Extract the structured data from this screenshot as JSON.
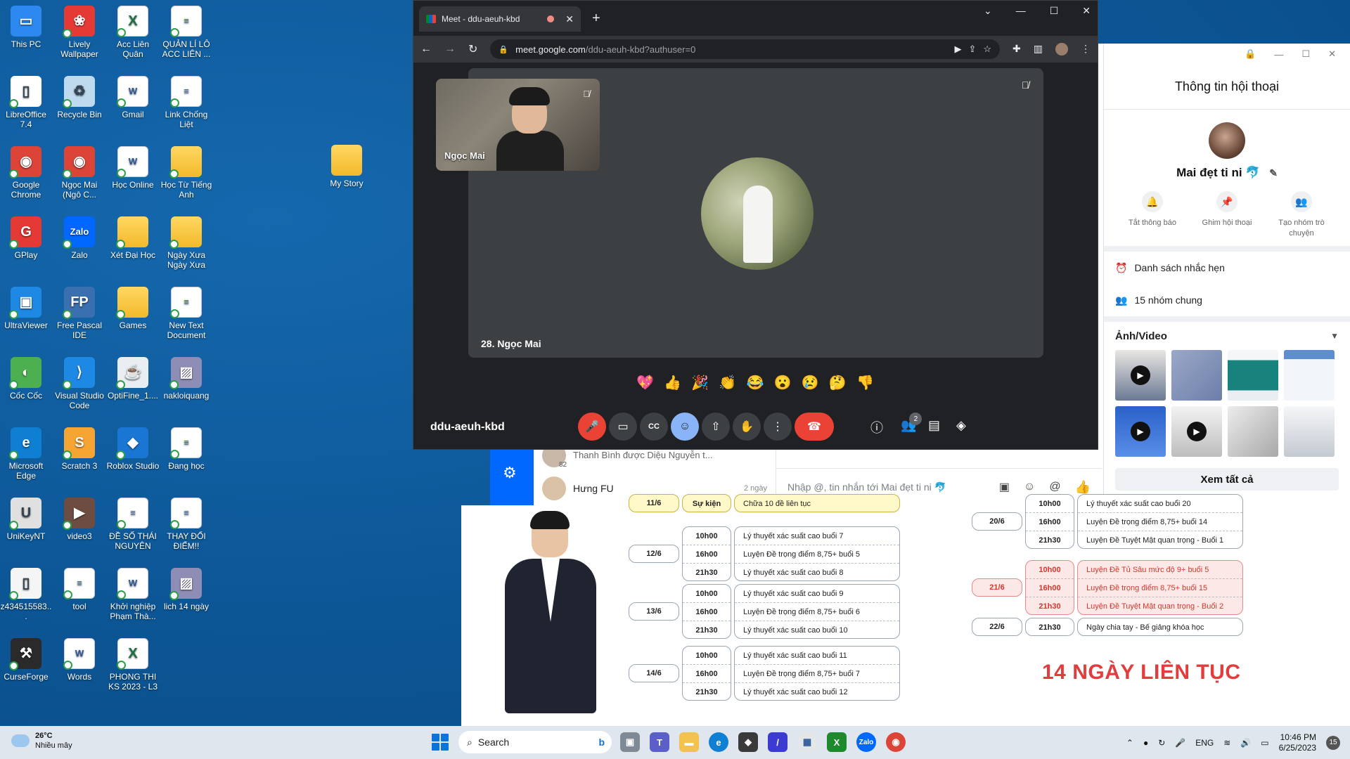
{
  "desktop": {
    "icons": [
      {
        "label": "This PC",
        "icon": "monitor-icon"
      },
      {
        "label": "LibreOffice 7.4",
        "icon": "libreoffice-icon"
      },
      {
        "label": "Google Chrome",
        "icon": "chrome-icon"
      },
      {
        "label": "GPlay",
        "icon": "gplay-icon"
      },
      {
        "label": "UltraViewer",
        "icon": "ultraviewer-icon"
      },
      {
        "label": "Cốc Cốc",
        "icon": "coccoc-icon"
      },
      {
        "label": "Microsoft Edge",
        "icon": "edge-icon"
      },
      {
        "label": "UniKeyNT",
        "icon": "unikey-icon"
      },
      {
        "label": "z434515583...",
        "icon": "file-icon"
      },
      {
        "label": "CurseForge",
        "icon": "curseforge-icon"
      },
      {
        "label": "Lively Wallpaper",
        "icon": "lively-icon"
      },
      {
        "label": "Recycle Bin",
        "icon": "recycle-bin-icon"
      },
      {
        "label": "Ngọc Mai (Ngô C...",
        "icon": "chrome-profile-icon"
      },
      {
        "label": "Zalo",
        "icon": "zalo-icon"
      },
      {
        "label": "Free Pascal IDE",
        "icon": "pascal-icon"
      },
      {
        "label": "Visual Studio Code",
        "icon": "vscode-icon"
      },
      {
        "label": "Scratch 3",
        "icon": "scratch-icon"
      },
      {
        "label": "video3",
        "icon": "video-icon"
      },
      {
        "label": "tool",
        "icon": "document-icon"
      },
      {
        "label": "Words",
        "icon": "word-icon"
      },
      {
        "label": "Acc Liên Quân",
        "icon": "excel-icon"
      },
      {
        "label": "Gmail",
        "icon": "word-icon"
      },
      {
        "label": "Học Online",
        "icon": "word-icon"
      },
      {
        "label": "Xét Đại Học",
        "icon": "folder-icon"
      },
      {
        "label": "Games",
        "icon": "folder-icon"
      },
      {
        "label": "OptiFine_1....",
        "icon": "java-icon"
      },
      {
        "label": "Roblox Studio",
        "icon": "roblox-icon"
      },
      {
        "label": "ĐỀ SỐ THÁI NGUYÊN",
        "icon": "document-icon"
      },
      {
        "label": "Khởi nghiệp Phạm Thà...",
        "icon": "word-icon"
      },
      {
        "label": "PHONG THI KS 2023 - L3",
        "icon": "excel-icon"
      },
      {
        "label": "QUẢN LÍ LÔ ACC LIÊN ...",
        "icon": "document-icon"
      },
      {
        "label": "Link Chống Liệt",
        "icon": "document-icon"
      },
      {
        "label": "Học Từ Tiếng Anh",
        "icon": "folder-icon"
      },
      {
        "label": "Ngày Xưa Ngày Xưa",
        "icon": "folder-icon"
      },
      {
        "label": "New Text Document",
        "icon": "document-icon"
      },
      {
        "label": "nakloiquang",
        "icon": "image-icon"
      },
      {
        "label": "Đang học",
        "icon": "document-icon"
      },
      {
        "label": "THAY ĐỔI ĐIỂM!!",
        "icon": "document-icon"
      },
      {
        "label": "lich 14 ngày",
        "icon": "image-icon"
      },
      {
        "label": "My Story",
        "icon": "folder-icon"
      }
    ]
  },
  "chrome": {
    "tab_title": "Meet - ddu-aeuh-kbd",
    "url_host": "meet.google.com",
    "url_path": "/ddu-aeuh-kbd?authuser=0"
  },
  "meet": {
    "pip_name": "Ngọc Mai",
    "stage_name": "28. Ngọc Mai",
    "meeting_code": "ddu-aeuh-kbd",
    "participants_count": "2",
    "reactions": [
      "💖",
      "👍",
      "🎉",
      "👏",
      "😂",
      "😮",
      "😢",
      "🤔",
      "👎"
    ]
  },
  "zalo": {
    "panel_title": "Thông tin hội thoại",
    "contact_name": "Mai đẹt ti ni 🐬",
    "actions": [
      {
        "label": "Tắt thông báo",
        "icon": "bell-icon"
      },
      {
        "label": "Ghim hội thoại",
        "icon": "pin-icon"
      },
      {
        "label": "Tạo nhóm trò chuyện",
        "icon": "group-add-icon"
      }
    ],
    "reminders": "Danh sách nhắc hẹn",
    "common_groups": "15 nhóm chung",
    "media_title": "Ảnh/Video",
    "see_all": "Xem tất cả",
    "input_placeholder": "Nhập @, tin nhắn tới Mai đẹt ti ni 🐬",
    "list": [
      {
        "name": "",
        "preview": "Thanh Bình được Diệu Nguyễn t...",
        "time": "",
        "badge": "82"
      },
      {
        "name": "Hưng FU",
        "preview": "",
        "time": "2 ngày",
        "badge": ""
      }
    ]
  },
  "schedule": {
    "title": "14 NGÀY LIÊN TỤC",
    "left": [
      {
        "day": "11/6",
        "times": [
          "Sự kiện"
        ],
        "items": [
          "Chữa 10 đề liên tục"
        ],
        "style": "yellow"
      },
      {
        "day": "12/6",
        "times": [
          "10h00",
          "16h00",
          "21h30"
        ],
        "items": [
          "Lý thuyết xác suất cao buổi 7",
          "Luyện Đề trọng điểm 8,75+ buổi 5",
          "Lý thuyết xác suất cao buổi 8"
        ],
        "style": ""
      },
      {
        "day": "13/6",
        "times": [
          "10h00",
          "16h00",
          "21h30"
        ],
        "items": [
          "Lý thuyết xác suất cao buổi 9",
          "Luyện Đề trọng điểm 8,75+ buổi 6",
          "Lý thuyết xác suất cao buổi 10"
        ],
        "style": ""
      },
      {
        "day": "14/6",
        "times": [
          "10h00",
          "16h00",
          "21h30"
        ],
        "items": [
          "Lý thuyết xác suất cao buổi 11",
          "Luyện Đề trọng điểm 8,75+ buổi 7",
          "Lý thuyết xác suất cao buổi 12"
        ],
        "style": ""
      }
    ],
    "right": [
      {
        "day": "20/6",
        "times": [
          "10h00",
          "16h00",
          "21h30"
        ],
        "items": [
          "Lý thuyết xác suất cao buổi 20",
          "Luyện Đề trọng điểm 8,75+ buổi 14",
          "Luyện Đề Tuyệt Mật quan trọng - Buổi 1"
        ],
        "style": ""
      },
      {
        "day": "21/6",
        "times": [
          "10h00",
          "16h00",
          "21h30"
        ],
        "items": [
          "Luyện Đề Tủ Sâu mức độ 9+ buổi 5",
          "Luyện Đề trọng điểm 8,75+ buổi 15",
          "Luyện Đề Tuyệt Mật quan trọng - Buổi 2"
        ],
        "style": "pink"
      },
      {
        "day": "22/6",
        "times": [
          "21h30"
        ],
        "items": [
          "Ngày chia tay - Bế giảng khóa học"
        ],
        "style": ""
      }
    ]
  },
  "taskbar": {
    "temperature": "26°C",
    "weather": "Nhiều mây",
    "search": "Search",
    "lang": "ENG",
    "time": "10:46 PM",
    "date": "6/25/2023",
    "notifications": "15"
  }
}
